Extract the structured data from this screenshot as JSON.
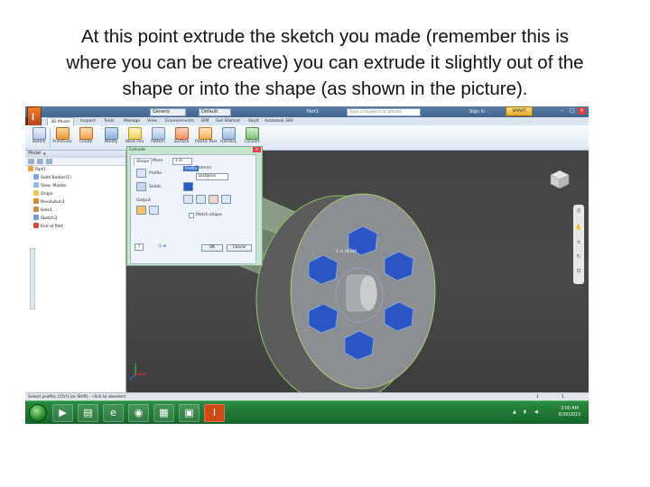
{
  "caption": {
    "line1": "At this point extrude the sketch you made (remember this is",
    "line2": "where you can be creative) you can extrude it slightly out of the",
    "line3": "shape or into the shape (as shown in the picture)."
  },
  "titlebar": {
    "app_icon": "inventor-logo-icon",
    "qa_material": "Generic",
    "qa_appearance": "Default",
    "filename": "Part1",
    "search_placeholder": "Type a keyword or phrase",
    "sign_in": "Sign In",
    "help": "SMART HELP"
  },
  "ribbon": {
    "tabs": [
      "3D Model",
      "Inspect",
      "Tools",
      "Manage",
      "View",
      "Environments",
      "BIM",
      "Get Started",
      "Vault",
      "Autodesk 360"
    ],
    "buttons": [
      {
        "label": "Sketch",
        "icon": "sketch-icon"
      },
      {
        "label": "Primitives",
        "icon": "primitives-icon"
      },
      {
        "label": "Create",
        "icon": "create-icon"
      },
      {
        "label": "Modify",
        "icon": "modify-icon"
      },
      {
        "label": "Work Fea",
        "icon": "work-features-icon"
      },
      {
        "label": "Pattern",
        "icon": "pattern-icon"
      },
      {
        "label": "Surface",
        "icon": "surface-icon"
      },
      {
        "label": "Plastic Part",
        "icon": "plastic-part-icon"
      },
      {
        "label": "Harness",
        "icon": "harness-icon"
      },
      {
        "label": "Convert",
        "icon": "convert-icon"
      }
    ]
  },
  "browser": {
    "title": "Model",
    "items": [
      "Part1",
      "Solid Bodies(1)",
      "View: Master",
      "Origin",
      "Revolution1",
      "Hole1",
      "Sketch3",
      "End of Part"
    ]
  },
  "dialog": {
    "title": "Extrude",
    "tabs": [
      "Shape",
      "More"
    ],
    "profile_label": "Profile",
    "solids_label": "Solids",
    "output_label": "Output",
    "extents_label": "Extents",
    "extent_type": "Distance",
    "distance": "1 in",
    "pick_tip": "Profile",
    "match_shape": "Match shape",
    "ok": "OK",
    "cancel": "Cancel"
  },
  "viewport": {
    "dimension_label": "1 in [0.00]"
  },
  "status": {
    "message": "Select profile; [Ctrl] (or Shift) - click to deselect",
    "count1": "1",
    "count2": "1"
  },
  "taskbar": {
    "time": "3:00 AM",
    "date": "6/30/2015"
  },
  "colors": {
    "profile_blue": "#2c55c4",
    "ribbon_bg": "#dce6f2",
    "taskbar_green": "#1e7a36"
  }
}
